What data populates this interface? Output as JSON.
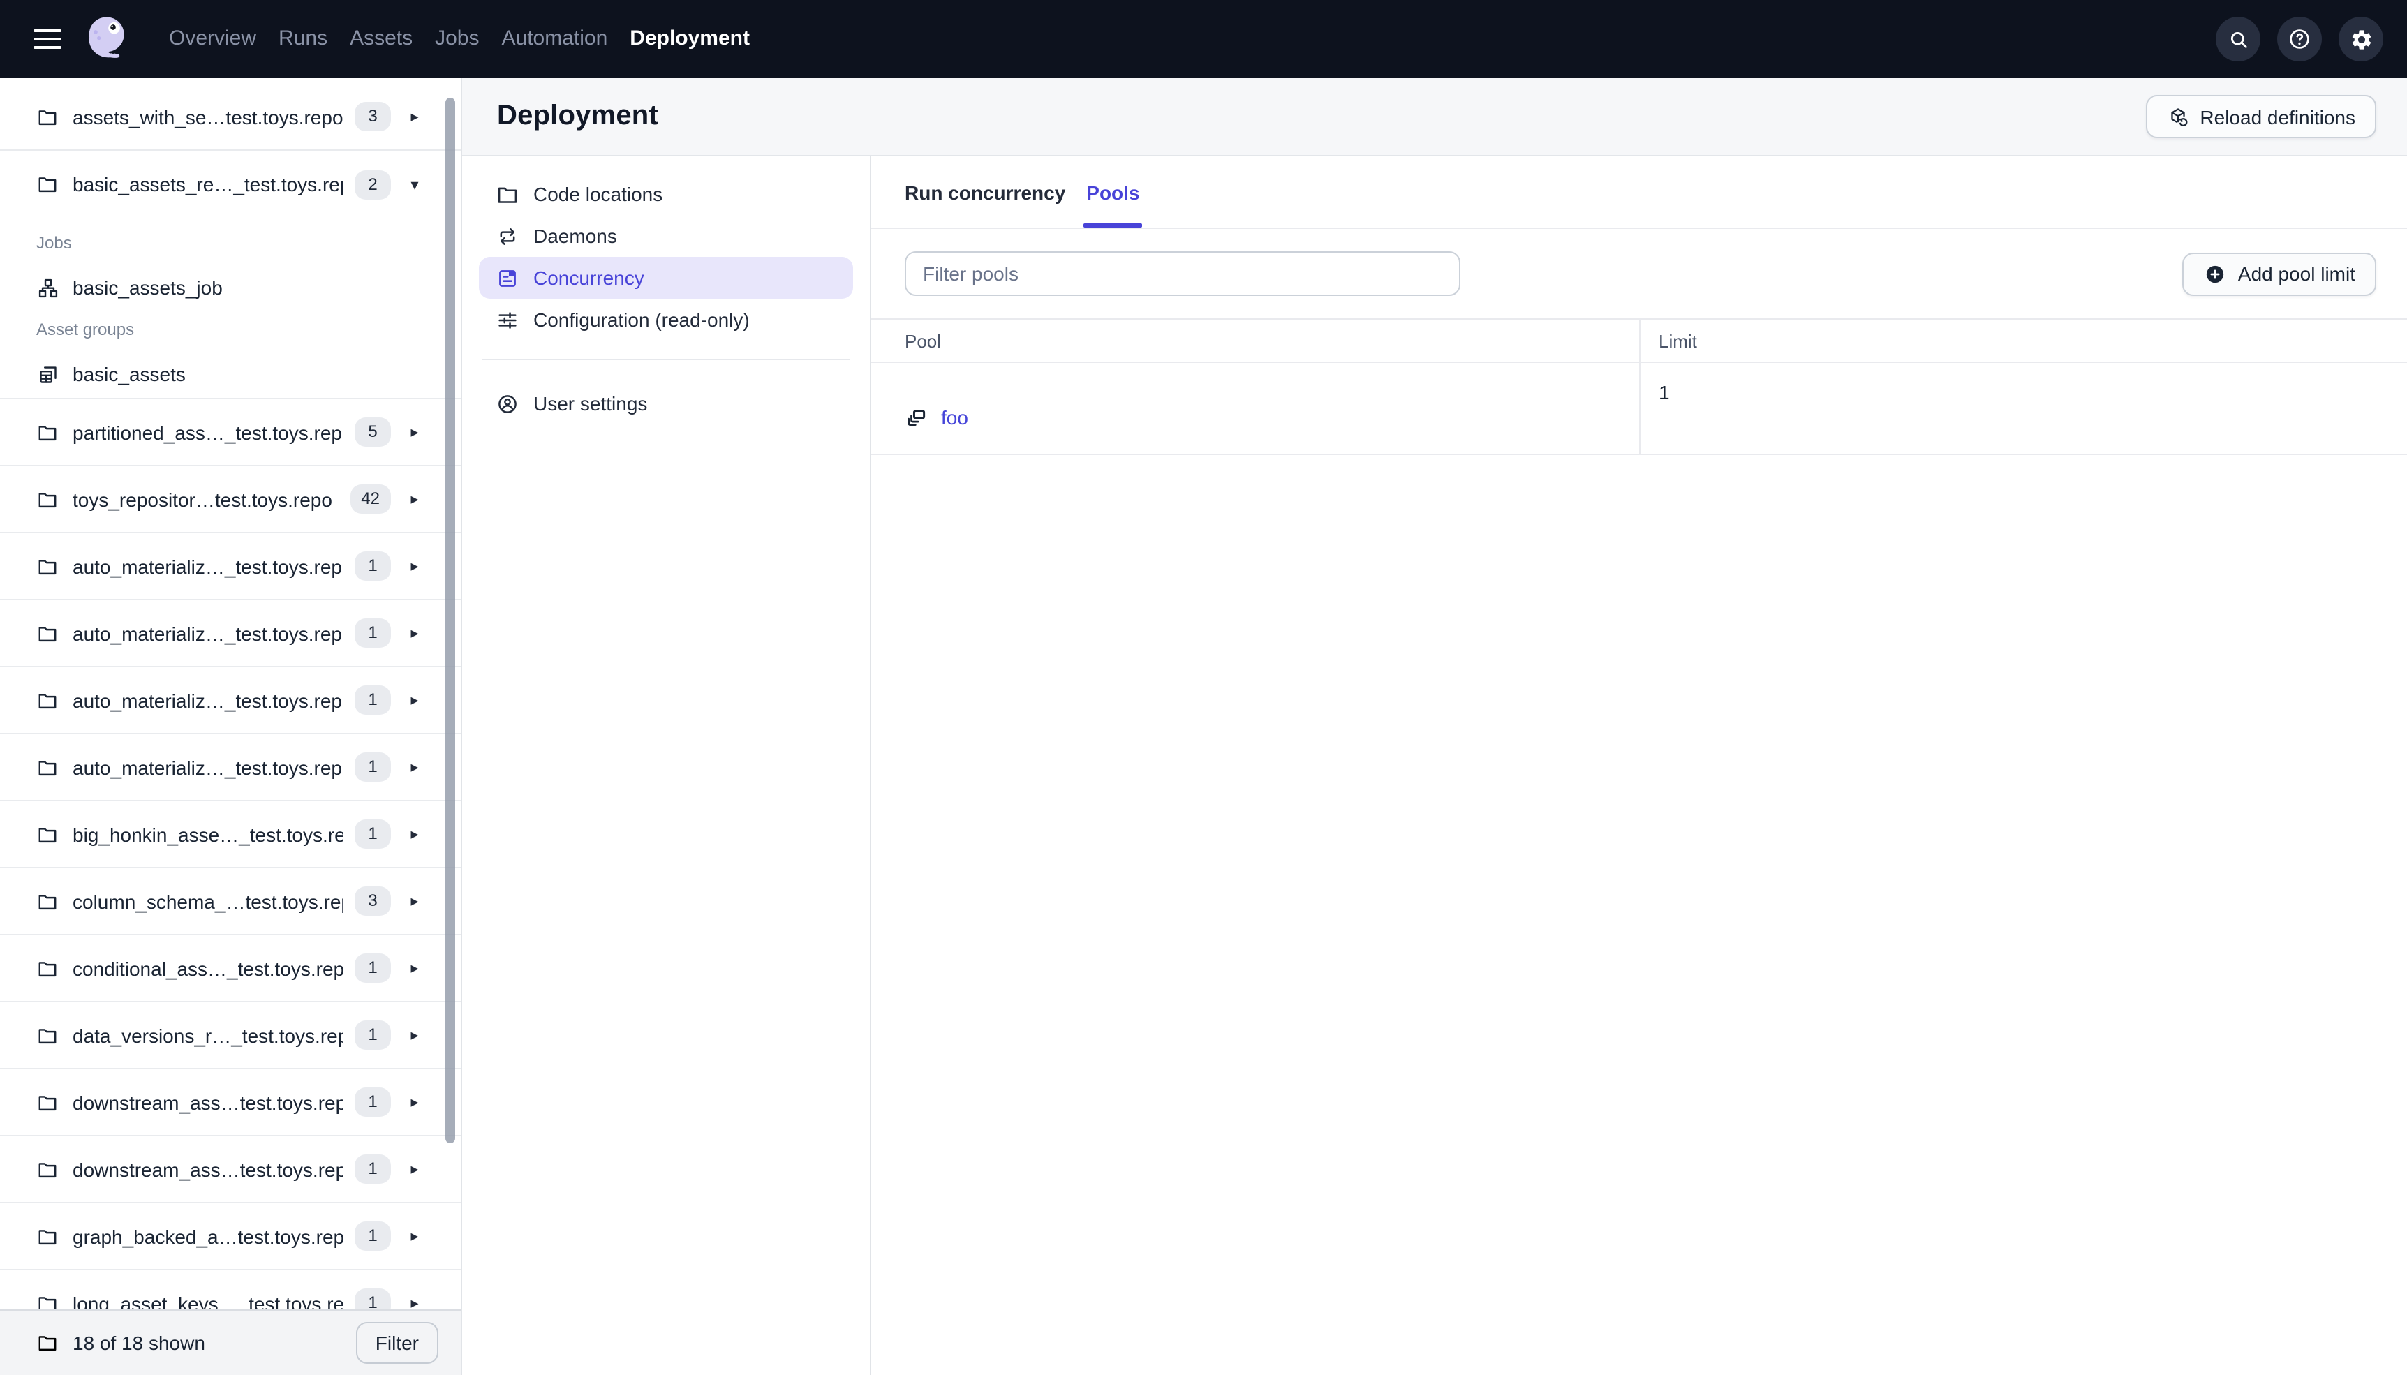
{
  "topnav": {
    "logo": "dagster-octopus-logo",
    "items": [
      {
        "label": "Overview",
        "active": false
      },
      {
        "label": "Runs",
        "active": false
      },
      {
        "label": "Assets",
        "active": false
      },
      {
        "label": "Jobs",
        "active": false
      },
      {
        "label": "Automation",
        "active": false
      },
      {
        "label": "Deployment",
        "active": true
      }
    ],
    "actions": [
      {
        "icon": "search-icon"
      },
      {
        "icon": "help-icon"
      },
      {
        "icon": "gear-icon"
      }
    ]
  },
  "sidebar": {
    "repos": [
      {
        "icon": "folder-icon",
        "label": "assets_with_se…test.toys.repo",
        "count": "3",
        "expanded": false
      },
      {
        "icon": "folder-icon",
        "label": "basic_assets_re…_test.toys.rep",
        "count": "2",
        "expanded": true,
        "sections": [
          {
            "title": "Jobs",
            "items": [
              {
                "icon": "job-icon",
                "label": "basic_assets_job"
              }
            ]
          },
          {
            "title": "Asset groups",
            "items": [
              {
                "icon": "asset-group-icon",
                "label": "basic_assets"
              }
            ]
          }
        ]
      },
      {
        "icon": "folder-icon",
        "label": "partitioned_ass…_test.toys.rep",
        "count": "5",
        "expanded": false
      },
      {
        "icon": "folder-icon",
        "label": "toys_repositor…test.toys.repo",
        "count": "42",
        "expanded": false
      },
      {
        "icon": "folder-icon",
        "label": "auto_materializ…_test.toys.repo",
        "count": "1",
        "expanded": false
      },
      {
        "icon": "folder-icon",
        "label": "auto_materializ…_test.toys.repo",
        "count": "1",
        "expanded": false
      },
      {
        "icon": "folder-icon",
        "label": "auto_materializ…_test.toys.repo",
        "count": "1",
        "expanded": false
      },
      {
        "icon": "folder-icon",
        "label": "auto_materializ…_test.toys.repo",
        "count": "1",
        "expanded": false
      },
      {
        "icon": "folder-icon",
        "label": "big_honkin_asse…_test.toys.rep",
        "count": "1",
        "expanded": false
      },
      {
        "icon": "folder-icon",
        "label": "column_schema_…test.toys.rep",
        "count": "3",
        "expanded": false
      },
      {
        "icon": "folder-icon",
        "label": "conditional_ass…_test.toys.repo",
        "count": "1",
        "expanded": false
      },
      {
        "icon": "folder-icon",
        "label": "data_versions_r…_test.toys.rep",
        "count": "1",
        "expanded": false
      },
      {
        "icon": "folder-icon",
        "label": "downstream_ass…test.toys.rep",
        "count": "1",
        "expanded": false
      },
      {
        "icon": "folder-icon",
        "label": "downstream_ass…test.toys.rep",
        "count": "1",
        "expanded": false
      },
      {
        "icon": "folder-icon",
        "label": "graph_backed_a…test.toys.repo",
        "count": "1",
        "expanded": false
      },
      {
        "icon": "folder-icon",
        "label": "long_asset_keys…_test.toys.rep",
        "count": "1",
        "expanded": false
      }
    ],
    "footer": {
      "icon": "folder-icon",
      "summary": "18 of 18 shown",
      "filter_label": "Filter"
    }
  },
  "page": {
    "title": "Deployment",
    "reload_button": {
      "icon": "reload-cube-icon",
      "label": "Reload definitions"
    }
  },
  "settings_nav": {
    "items": [
      {
        "icon": "folder-icon",
        "label": "Code locations",
        "active": false
      },
      {
        "icon": "daemons-icon",
        "label": "Daemons",
        "active": false
      },
      {
        "icon": "concurrency-icon",
        "label": "Concurrency",
        "active": true
      },
      {
        "icon": "tune-icon",
        "label": "Configuration (read-only)",
        "active": false
      }
    ],
    "secondary": [
      {
        "icon": "user-icon",
        "label": "User settings",
        "active": false
      }
    ]
  },
  "tabs": [
    {
      "label": "Run concurrency",
      "active": false
    },
    {
      "label": "Pools",
      "active": true
    }
  ],
  "pools": {
    "filter_placeholder": "Filter pools",
    "add_button": {
      "icon": "plus-circle-icon",
      "label": "Add pool limit"
    },
    "table": {
      "columns": [
        "Pool",
        "Limit"
      ],
      "rows": [
        {
          "icon": "pool-stack-icon",
          "pool": "foo",
          "limit": "1"
        }
      ]
    }
  },
  "colors": {
    "nav_bg": "#0D121E",
    "accent": "#4843D8",
    "link": "#4645D9",
    "selected_bg": "#E8E6FB",
    "header_bg": "#F6F7F9",
    "badge_bg": "#E9EBEF",
    "border": "#E9EAEE"
  }
}
